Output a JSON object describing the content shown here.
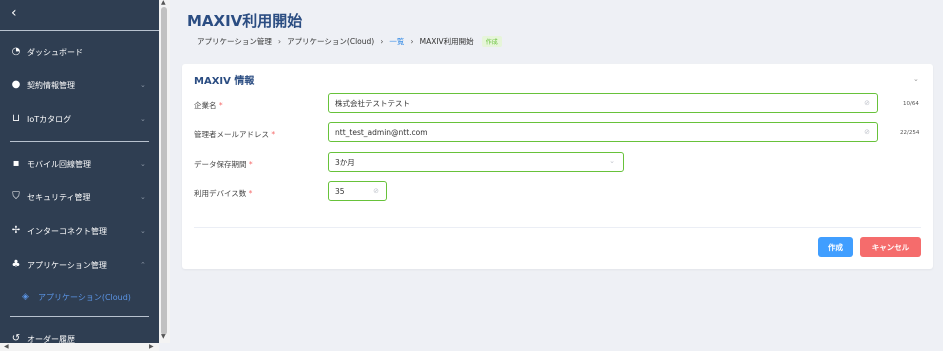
{
  "sidebar": {
    "back_icon": "chevron-left-icon",
    "items": [
      {
        "label": "ダッシュボード",
        "icon": "dashboard-gauge-icon",
        "has_arrow": false
      },
      {
        "label": "契約情報管理",
        "icon": "user-icon",
        "has_arrow": true
      },
      {
        "label": "IoTカタログ",
        "icon": "cart-icon",
        "has_arrow": true
      },
      {
        "label": "モバイル回線管理",
        "icon": "sim-card-icon",
        "has_arrow": true
      },
      {
        "label": "セキュリティ管理",
        "icon": "shield-check-icon",
        "has_arrow": true
      },
      {
        "label": "インターコネクト管理",
        "icon": "network-icon",
        "has_arrow": true
      },
      {
        "label": "アプリケーション管理",
        "icon": "apps-icon",
        "has_arrow": true,
        "expanded": true
      },
      {
        "label": "オーダー履歴",
        "icon": "history-icon",
        "has_arrow": false
      }
    ],
    "sub_item": {
      "label": "アプリケーション(Cloud)",
      "icon": "layers-icon"
    }
  },
  "page": {
    "title": "MAXIV利用開始",
    "breadcrumb": [
      {
        "label": "アプリケーション管理",
        "link": false
      },
      {
        "label": "アプリケーション(Cloud)",
        "link": false
      },
      {
        "label": "一覧",
        "link": true
      },
      {
        "label": "MAXIV利用開始",
        "link": false
      }
    ],
    "badge": "作成"
  },
  "form": {
    "section_title": "MAXIV 情報",
    "required_mark": "*",
    "fields": {
      "company": {
        "label": "企業名",
        "value": "株式会社テストテスト",
        "count": "10/64"
      },
      "admin_email": {
        "label": "管理者メールアドレス",
        "value": "ntt_test_admin@ntt.com",
        "count": "22/254"
      },
      "retention": {
        "label": "データ保存期間",
        "value": "3か月"
      },
      "devices": {
        "label": "利用デバイス数",
        "value": "35"
      }
    },
    "buttons": {
      "create": "作成",
      "cancel": "キャンセル"
    }
  },
  "colors": {
    "sidebar_bg": "#2f3e52",
    "title_color": "#2b4d82",
    "valid_border": "#67c23a",
    "primary": "#409eff",
    "danger": "#f56c6c",
    "active_sub": "#5b95e6"
  }
}
